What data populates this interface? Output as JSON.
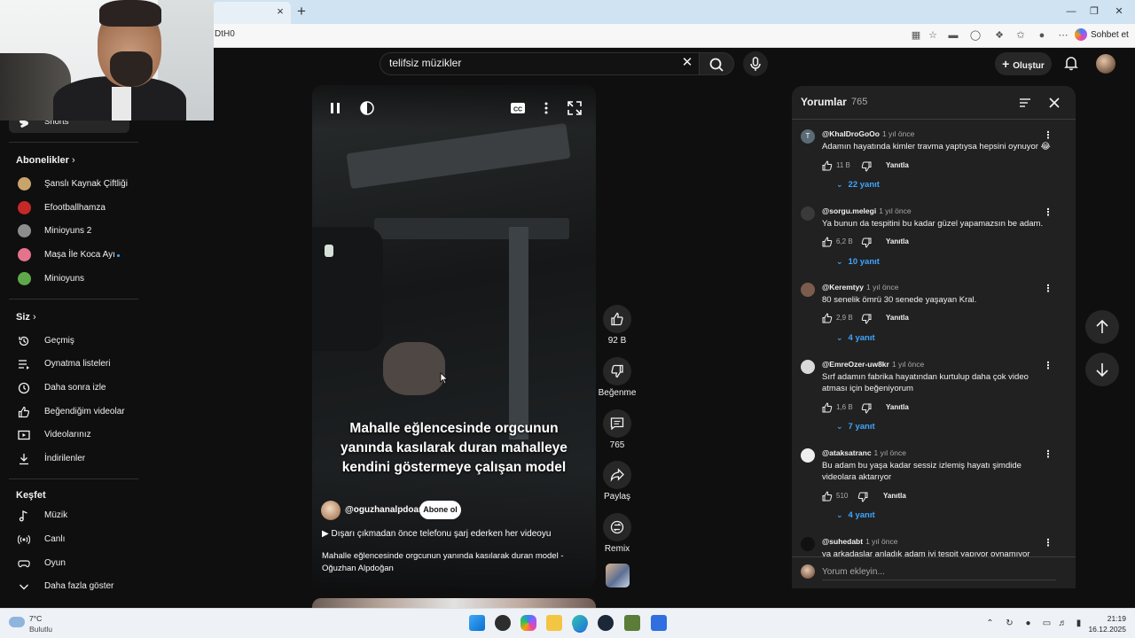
{
  "browser": {
    "url_fragment": "DtH0",
    "tab_close": "×",
    "tab_new": "+",
    "chat_button": "Sohbet et"
  },
  "header": {
    "search_value": "telifsiz müzikler",
    "search_clear": "✕",
    "create_label": "Oluştur"
  },
  "sidebar": {
    "shorts": "Shorts",
    "subscriptions_title": "Abonelikler",
    "subscriptions": [
      {
        "label": "Şanslı Kaynak Çiftliği",
        "color": "#c9a46a"
      },
      {
        "label": "Efootballhamza",
        "color": "#c62828"
      },
      {
        "label": "Minioyuns 2",
        "color": "#8d8d8d"
      },
      {
        "label": "Maşa İle Koca Ayı",
        "color": "#e5738b"
      },
      {
        "label": "Minioyuns",
        "color": "#5fa84a"
      }
    ],
    "you_title": "Siz",
    "you_items": [
      {
        "label": "Geçmiş",
        "icon": "history-icon"
      },
      {
        "label": "Oynatma listeleri",
        "icon": "playlist-icon"
      },
      {
        "label": "Daha sonra izle",
        "icon": "clock-icon"
      },
      {
        "label": "Beğendiğim videolar",
        "icon": "thumb-up-icon"
      },
      {
        "label": "Videolarınız",
        "icon": "your-videos-icon"
      },
      {
        "label": "İndirilenler",
        "icon": "download-icon"
      }
    ],
    "explore_title": "Keşfet",
    "explore_items": [
      {
        "label": "Müzik",
        "icon": "music-icon"
      },
      {
        "label": "Canlı",
        "icon": "live-icon"
      },
      {
        "label": "Oyun",
        "icon": "gaming-icon"
      },
      {
        "label": "Daha fazla göster",
        "icon": "chevron-down-icon"
      }
    ]
  },
  "video": {
    "caption": "Mahalle eğlencesinde orgcunun yanında kasılarak duran mahalleye kendini göstermeye çalışan model",
    "channel": "@oguzhanalpdoan",
    "subscribe_label": "Abone ol",
    "playlist_text": "Dışarı çıkmadan önce telefonu şarj ederken her videoyu",
    "title": "Mahalle eğlencesinde orgcunun yanında kasılarak duran model - Oğuzhan Alpdoğan"
  },
  "actions": {
    "likes": "92 B",
    "dislike": "Beğenme",
    "comments": "765",
    "share": "Paylaş",
    "remix": "Remix"
  },
  "comments_panel": {
    "title": "Yorumlar",
    "count": "765",
    "reply_label": "Yanıtla",
    "input_placeholder": "Yorum ekleyin...",
    "items": [
      {
        "user": "@KhalDroGoOo",
        "time": "1 yıl önce",
        "text": "Adamın hayatında kimler travma yaptıysa hepsini oynuyor 😂",
        "likes": "11 B",
        "replies": "22 yanıt",
        "avatar_letter": "T",
        "avatar_color": "#5a6b74"
      },
      {
        "user": "@sorgu.melegi",
        "time": "1 yıl önce",
        "text": "Ya bunun da tespitini bu kadar güzel yapamazsın be adam.",
        "likes": "6,2 B",
        "replies": "10 yanıt",
        "avatar_letter": "",
        "avatar_color": "#3a3a3a"
      },
      {
        "user": "@Keremtyy",
        "time": "1 yıl önce",
        "text": "80 senelik ömrü 30 senede yaşayan Kral.",
        "likes": "2,9 B",
        "replies": "4 yanıt",
        "avatar_letter": "",
        "avatar_color": "#7b5c4c"
      },
      {
        "user": "@EmreOzer-uw8kr",
        "time": "1 yıl önce",
        "text": "Sırf adamın fabrika hayatından kurtulup daha çok video atması için beğeniyorum",
        "likes": "1,6 B",
        "replies": "7 yanıt",
        "avatar_letter": "",
        "avatar_color": "#d9d9d9"
      },
      {
        "user": "@ataksatranc",
        "time": "1 yıl önce",
        "text": "Bu adam bu yaşa kadar sessiz izlemiş hayatı şimdide videolara aktarıyor",
        "likes": "510",
        "replies": "4 yanıt",
        "avatar_letter": "",
        "avatar_color": "#eeeeee"
      },
      {
        "user": "@suhedabt",
        "time": "1 yıl önce",
        "text": "ya arkadaşlar anladık adam iyi tespit yapıyor oynamıyor yaşıyor",
        "likes": "",
        "replies": "",
        "avatar_letter": "",
        "avatar_color": "#111111"
      }
    ]
  },
  "taskbar": {
    "weather_temp": "7°C",
    "weather_desc": "Bulutlu",
    "time": "21:19",
    "date": "16.12.2025"
  }
}
